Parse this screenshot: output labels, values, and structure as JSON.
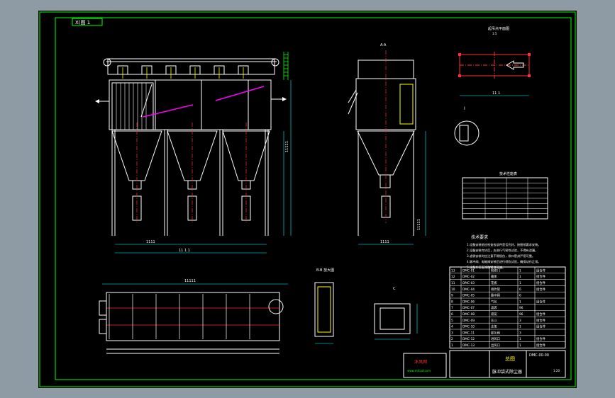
{
  "sheet": {
    "tag": "X(图 1",
    "view_top_label": "A-A",
    "plan_label": "起吊点平面图",
    "plan_scale": "1:5",
    "detail_label": "I",
    "section_label": "B-B 放大图",
    "hood_label": "C",
    "table_title": "技术性能表",
    "notes_title": "技术要求",
    "notes": [
      "1.设备安装前应检查各部件是否完好，按图纸要求安装。",
      "2.设备安装完毕后，应进行气密性试验，不得有泄漏。",
      "3.滤袋安装时应注意不得损伤，袋口密封严密可靠。",
      "4.脉冲阀、电磁阀安装后进行喷吹试验，确保动作正常。",
      "5.设备外表面涂防锈漆两遍。"
    ],
    "parts_rows": [
      {
        "no": "13",
        "code": "DMC-01",
        "name": "检修门",
        "qty": "1",
        "mat": "组合件"
      },
      {
        "no": "12",
        "code": "DMC-02",
        "name": "箱体",
        "qty": "1",
        "mat": "组合件"
      },
      {
        "no": "11",
        "code": "DMC-03",
        "name": "花板",
        "qty": "1",
        "mat": "组合件"
      },
      {
        "no": "10",
        "code": "DMC-04",
        "name": "喷吹管",
        "qty": "6",
        "mat": "组合件"
      },
      {
        "no": "9",
        "code": "DMC-05",
        "name": "脉冲阀",
        "qty": "6",
        "mat": ""
      },
      {
        "no": "8",
        "code": "DMC-06",
        "name": "气包",
        "qty": "1",
        "mat": "组合件"
      },
      {
        "no": "7",
        "code": "DMC-07",
        "name": "滤袋",
        "qty": "96",
        "mat": ""
      },
      {
        "no": "6",
        "code": "DMC-08",
        "name": "袋笼",
        "qty": "96",
        "mat": "组合件"
      },
      {
        "no": "5",
        "code": "DMC-09",
        "name": "灰斗",
        "qty": "3",
        "mat": "组合件"
      },
      {
        "no": "4",
        "code": "DMC-10",
        "name": "支架",
        "qty": "1",
        "mat": "组合件"
      },
      {
        "no": "3",
        "code": "DMC-11",
        "name": "卸灰阀",
        "qty": "3",
        "mat": ""
      },
      {
        "no": "2",
        "code": "DMC-12",
        "name": "进风口",
        "qty": "1",
        "mat": "组合件"
      },
      {
        "no": "1",
        "code": "DMC-13",
        "name": "出风口",
        "qty": "1",
        "mat": "组合件"
      }
    ],
    "title_block": {
      "drawing_name": "脉冲袋式除尘器",
      "sheet_name": "总图",
      "drawing_no": "DMC-00-00",
      "scale": "1:20"
    },
    "stamp_text": "沐风网",
    "stamp_sub": "www.mfcad.com"
  },
  "colors": {
    "frame": "#00ff00",
    "line": "#ffffff",
    "center": "#ff3030",
    "dim": "#00ffff",
    "accent": "#ff00ff",
    "yellow": "#ffff00",
    "text": "#ffffff"
  }
}
